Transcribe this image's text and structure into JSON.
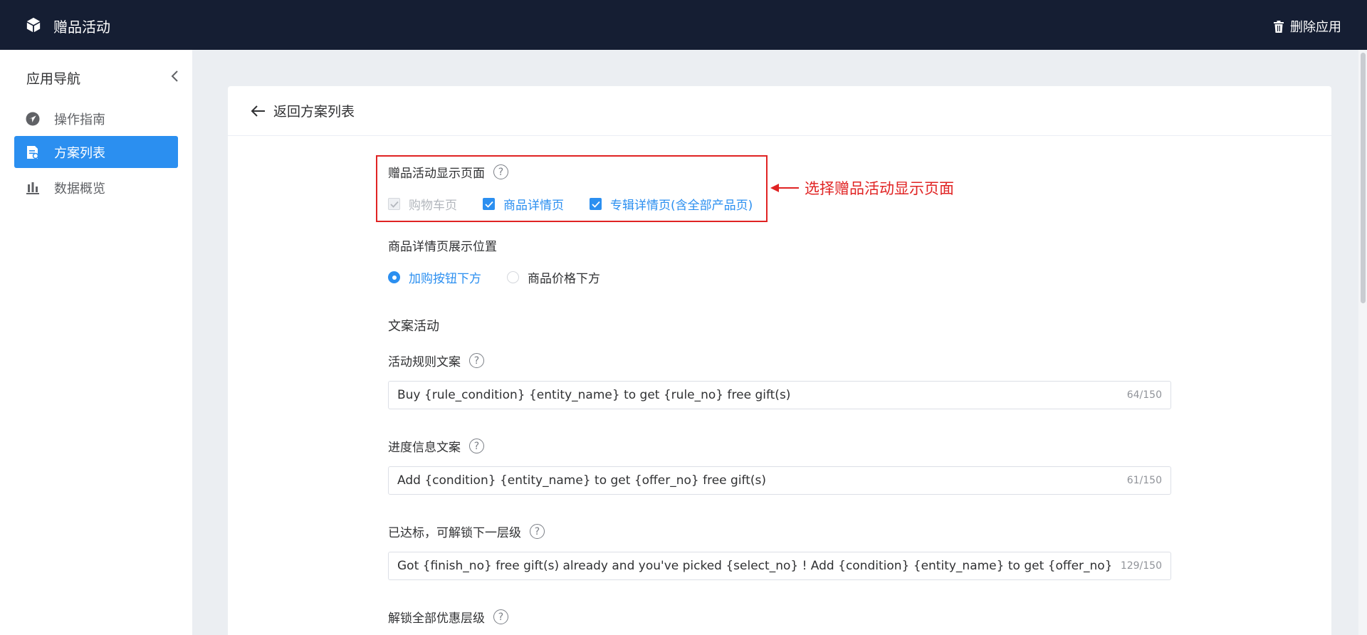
{
  "app": {
    "title": "赠品活动",
    "delete_label": "删除应用"
  },
  "sidebar": {
    "title": "应用导航",
    "items": [
      {
        "label": "操作指南",
        "icon": "navigation-icon"
      },
      {
        "label": "方案列表",
        "icon": "document-icon",
        "active": true
      },
      {
        "label": "数据概览",
        "icon": "bar-chart-icon"
      }
    ]
  },
  "card": {
    "back_label": "返回方案列表"
  },
  "display_pages": {
    "label": "赠品活动显示页面",
    "options": [
      {
        "label": "购物车页",
        "checked": true,
        "disabled": true
      },
      {
        "label": "商品详情页",
        "checked": true,
        "disabled": false
      },
      {
        "label": "专辑详情页(含全部产品页)",
        "checked": true,
        "disabled": false
      }
    ]
  },
  "annotation": {
    "text": "选择赠品活动显示页面"
  },
  "detail_position": {
    "label": "商品详情页展示位置",
    "options": [
      {
        "label": "加购按钮下方",
        "checked": true
      },
      {
        "label": "商品价格下方",
        "checked": false
      }
    ]
  },
  "copy_section": {
    "title": "文案活动",
    "fields": [
      {
        "label": "活动规则文案",
        "value": "Buy {rule_condition} {entity_name} to get {rule_no} free gift(s)",
        "count": "64/150"
      },
      {
        "label": "进度信息文案",
        "value": "Add {condition} {entity_name}  to get {offer_no} free gift(s)",
        "count": "61/150"
      },
      {
        "label": "已达标，可解锁下一层级",
        "value": "Got {finish_no} free gift(s) already and you've picked {select_no} ! Add {condition} {entity_name} to get {offer_no} free gif",
        "count": "129/150"
      },
      {
        "label": "解锁全部优惠层级"
      }
    ]
  },
  "colors": {
    "topbar": "#151e33",
    "primary": "#2b8ff0",
    "annotation": "#e02323"
  }
}
